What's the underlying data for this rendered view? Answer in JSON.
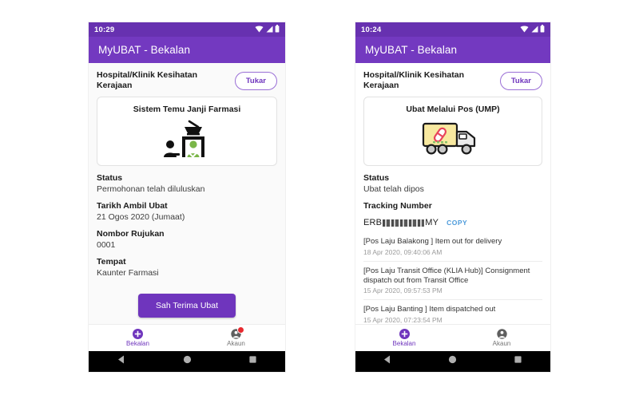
{
  "app": {
    "name": "MyUBAT",
    "bar_title": "MyUBAT - Bekalan",
    "accent_color": "#6f35bd",
    "appbar_color": "#7339c0",
    "statusbar_color": "#6731b0"
  },
  "icons": {
    "wifi": "wifi-icon",
    "signal": "signal-icon",
    "battery": "battery-icon",
    "nav_supply": "plus-circle-icon",
    "nav_account": "account-circle-icon",
    "sysnav_back": "back-triangle-icon",
    "sysnav_home": "home-circle-icon",
    "sysnav_recents": "recents-square-icon"
  },
  "phones": [
    {
      "id": "phone-appointment",
      "status_bar": {
        "time": "10:29"
      },
      "facility": {
        "name": "Hospital/Klinik Kesihatan Kerajaan",
        "switch_label": "Tukar"
      },
      "hero": {
        "title": "Sistem Temu Janji Farmasi",
        "art": "pharmacy-counter-illustration"
      },
      "fields": [
        {
          "label": "Status",
          "value": "Permohonan telah diluluskan"
        },
        {
          "label": "Tarikh Ambil Ubat",
          "value": "21 Ogos 2020 (Jumaat)"
        },
        {
          "label": "Nombor Rujukan",
          "value": "0001"
        },
        {
          "label": "Tempat",
          "value": "Kaunter Farmasi"
        }
      ],
      "cta_label": "Sah Terima Ubat",
      "bottom_nav": [
        {
          "label": "Bekalan",
          "icon": "plus-circle-icon",
          "active": true,
          "badge": false
        },
        {
          "label": "Akaun",
          "icon": "account-circle-icon",
          "active": false,
          "badge": true
        }
      ]
    },
    {
      "id": "phone-parcel",
      "status_bar": {
        "time": "10:24"
      },
      "facility": {
        "name": "Hospital/Klinik Kesihatan Kerajaan",
        "switch_label": "Tukar"
      },
      "hero": {
        "title": "Ubat Melalui Pos (UMP)",
        "art": "delivery-truck-illustration"
      },
      "fields": [
        {
          "label": "Status",
          "value": "Ubat telah dipos"
        },
        {
          "label": "Tracking Number",
          "value": ""
        }
      ],
      "tracking": {
        "prefix": "ERB",
        "masked": "█░█░█",
        "suffix": "MY",
        "copy_label": "COPY"
      },
      "events": [
        {
          "text": "[Pos Laju Balakong ] Item out for delivery",
          "date": "18 Apr 2020, 09:40:06 AM"
        },
        {
          "text": "[Pos Laju Transit Office (KLIA Hub)] Consignment dispatch out from Transit Office",
          "date": "15 Apr 2020, 09:57:53 PM"
        },
        {
          "text": "[Pos Laju Banting ] Item dispatched out",
          "date": "15 Apr 2020, 07:23:54 PM"
        }
      ],
      "bottom_nav": [
        {
          "label": "Bekalan",
          "icon": "plus-circle-icon",
          "active": true,
          "badge": false
        },
        {
          "label": "Akaun",
          "icon": "account-circle-icon",
          "active": false,
          "badge": false
        }
      ]
    }
  ]
}
